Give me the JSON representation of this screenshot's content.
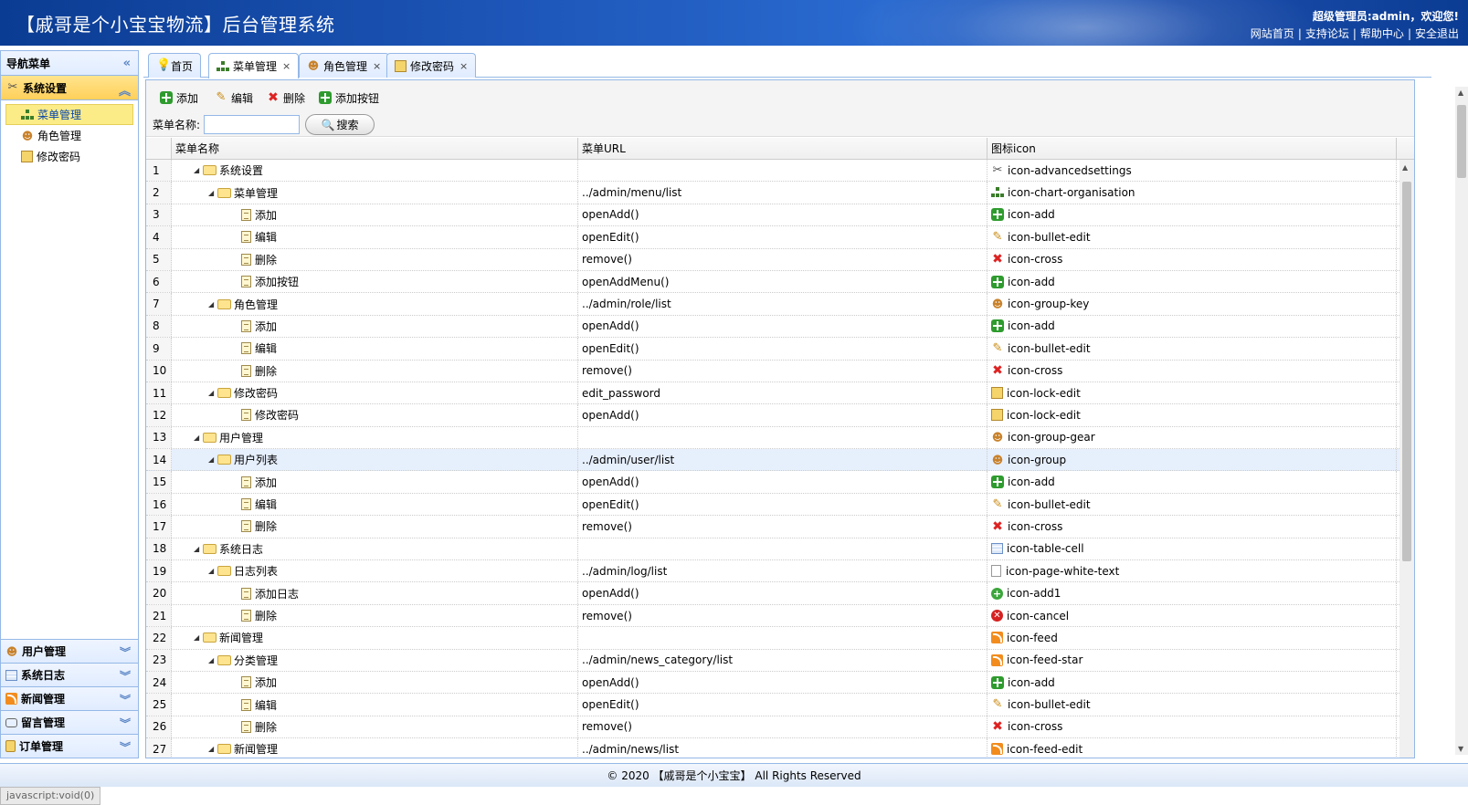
{
  "header": {
    "title": "【戚哥是个小宝宝物流】后台管理系统",
    "welcome": "超级管理员:admin，欢迎您!",
    "links": [
      "网站首页",
      "支持论坛",
      "帮助中心",
      "安全退出"
    ],
    "separator": "|"
  },
  "nav": {
    "title": "导航菜单",
    "collapse_glyph": "«",
    "sections": [
      {
        "label": "系统设置",
        "icon": "advancedsettings-icon",
        "expanded": true,
        "items": [
          {
            "label": "菜单管理",
            "icon": "chart-organisation-icon",
            "selected": true
          },
          {
            "label": "角色管理",
            "icon": "group-key-icon",
            "selected": false
          },
          {
            "label": "修改密码",
            "icon": "lock-edit-icon",
            "selected": false
          }
        ]
      },
      {
        "label": "用户管理",
        "icon": "group-gear-icon",
        "expanded": false
      },
      {
        "label": "系统日志",
        "icon": "table-cell-icon",
        "expanded": false
      },
      {
        "label": "新闻管理",
        "icon": "feed-icon",
        "expanded": false
      },
      {
        "label": "留言管理",
        "icon": "comment-icon",
        "expanded": false
      },
      {
        "label": "订单管理",
        "icon": "order-icon",
        "expanded": false
      }
    ]
  },
  "tabs": [
    {
      "label": "首页",
      "icon": "bulb-icon",
      "closable": false,
      "active": false
    },
    {
      "label": "菜单管理",
      "icon": "chart-organisation-icon",
      "closable": true,
      "active": true
    },
    {
      "label": "角色管理",
      "icon": "group-key-icon",
      "closable": true,
      "active": false
    },
    {
      "label": "修改密码",
      "icon": "lock-edit-icon",
      "closable": true,
      "active": false
    }
  ],
  "toolbar": {
    "add": "添加",
    "edit": "编辑",
    "remove": "删除",
    "add_button": "添加按钮",
    "search_label": "菜单名称:",
    "search_value": "",
    "search_button": "搜索"
  },
  "grid": {
    "columns": [
      "菜单名称",
      "菜单URL",
      "图标icon"
    ],
    "rows": [
      {
        "n": "1",
        "level": 0,
        "type": "folder",
        "name": "系统设置",
        "url": "",
        "icon": "icon-advancedsettings",
        "icon_kind": "gear"
      },
      {
        "n": "2",
        "level": 1,
        "type": "folder",
        "name": "菜单管理",
        "url": "../admin/menu/list",
        "icon": "icon-chart-organisation",
        "icon_kind": "org"
      },
      {
        "n": "3",
        "level": 2,
        "type": "file",
        "name": "添加",
        "url": "openAdd()",
        "icon": "icon-add",
        "icon_kind": "plus"
      },
      {
        "n": "4",
        "level": 2,
        "type": "file",
        "name": "编辑",
        "url": "openEdit()",
        "icon": "icon-bullet-edit",
        "icon_kind": "pencil"
      },
      {
        "n": "5",
        "level": 2,
        "type": "file",
        "name": "删除",
        "url": "remove()",
        "icon": "icon-cross",
        "icon_kind": "cross"
      },
      {
        "n": "6",
        "level": 2,
        "type": "file",
        "name": "添加按钮",
        "url": "openAddMenu()",
        "icon": "icon-add",
        "icon_kind": "plus"
      },
      {
        "n": "7",
        "level": 1,
        "type": "folder",
        "name": "角色管理",
        "url": "../admin/role/list",
        "icon": "icon-group-key",
        "icon_kind": "group"
      },
      {
        "n": "8",
        "level": 2,
        "type": "file",
        "name": "添加",
        "url": "openAdd()",
        "icon": "icon-add",
        "icon_kind": "plus"
      },
      {
        "n": "9",
        "level": 2,
        "type": "file",
        "name": "编辑",
        "url": "openEdit()",
        "icon": "icon-bullet-edit",
        "icon_kind": "pencil"
      },
      {
        "n": "10",
        "level": 2,
        "type": "file",
        "name": "删除",
        "url": "remove()",
        "icon": "icon-cross",
        "icon_kind": "cross"
      },
      {
        "n": "11",
        "level": 1,
        "type": "folder",
        "name": "修改密码",
        "url": "edit_password",
        "icon": "icon-lock-edit",
        "icon_kind": "lock"
      },
      {
        "n": "12",
        "level": 2,
        "type": "file",
        "name": "修改密码",
        "url": "openAdd()",
        "icon": "icon-lock-edit",
        "icon_kind": "lock"
      },
      {
        "n": "13",
        "level": 0,
        "type": "folder",
        "name": "用户管理",
        "url": "",
        "icon": "icon-group-gear",
        "icon_kind": "group"
      },
      {
        "n": "14",
        "level": 1,
        "type": "folder",
        "name": "用户列表",
        "url": "../admin/user/list",
        "icon": "icon-group",
        "icon_kind": "group",
        "highlight": true
      },
      {
        "n": "15",
        "level": 2,
        "type": "file",
        "name": "添加",
        "url": "openAdd()",
        "icon": "icon-add",
        "icon_kind": "plus"
      },
      {
        "n": "16",
        "level": 2,
        "type": "file",
        "name": "编辑",
        "url": "openEdit()",
        "icon": "icon-bullet-edit",
        "icon_kind": "pencil"
      },
      {
        "n": "17",
        "level": 2,
        "type": "file",
        "name": "删除",
        "url": "remove()",
        "icon": "icon-cross",
        "icon_kind": "cross"
      },
      {
        "n": "18",
        "level": 0,
        "type": "folder",
        "name": "系统日志",
        "url": "",
        "icon": "icon-table-cell",
        "icon_kind": "table"
      },
      {
        "n": "19",
        "level": 1,
        "type": "folder",
        "name": "日志列表",
        "url": "../admin/log/list",
        "icon": "icon-page-white-text",
        "icon_kind": "page"
      },
      {
        "n": "20",
        "level": 2,
        "type": "file",
        "name": "添加日志",
        "url": "openAdd()",
        "icon": "icon-add1",
        "icon_kind": "add1"
      },
      {
        "n": "21",
        "level": 2,
        "type": "file",
        "name": "删除",
        "url": "remove()",
        "icon": "icon-cancel",
        "icon_kind": "cancel"
      },
      {
        "n": "22",
        "level": 0,
        "type": "folder",
        "name": "新闻管理",
        "url": "",
        "icon": "icon-feed",
        "icon_kind": "feed"
      },
      {
        "n": "23",
        "level": 1,
        "type": "folder",
        "name": "分类管理",
        "url": "../admin/news_category/list",
        "icon": "icon-feed-star",
        "icon_kind": "feed"
      },
      {
        "n": "24",
        "level": 2,
        "type": "file",
        "name": "添加",
        "url": "openAdd()",
        "icon": "icon-add",
        "icon_kind": "plus"
      },
      {
        "n": "25",
        "level": 2,
        "type": "file",
        "name": "编辑",
        "url": "openEdit()",
        "icon": "icon-bullet-edit",
        "icon_kind": "pencil"
      },
      {
        "n": "26",
        "level": 2,
        "type": "file",
        "name": "删除",
        "url": "remove()",
        "icon": "icon-cross",
        "icon_kind": "cross"
      },
      {
        "n": "27",
        "level": 1,
        "type": "folder",
        "name": "新闻管理",
        "url": "../admin/news/list",
        "icon": "icon-feed-edit",
        "icon_kind": "feed"
      }
    ]
  },
  "footer": {
    "text": "© 2020 【戚哥是个小宝宝】 All Rights Reserved"
  },
  "statusbar": {
    "text": "javascript:void(0)"
  },
  "colors": {
    "header_bg": "#1d56b8",
    "panel_border": "#95b8e7",
    "selected_bg": "#fbec88",
    "row_highlight": "#e6effc"
  }
}
